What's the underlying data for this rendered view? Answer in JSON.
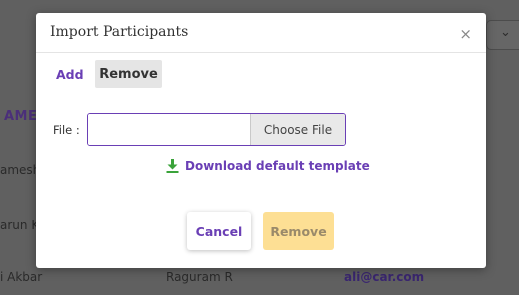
{
  "background": {
    "heading": "AME",
    "rows": [
      {
        "name": "amesh"
      },
      {
        "name": "arun K"
      },
      {
        "name": "i Akbar",
        "col2": "Raguram R",
        "email": "ali@car.com"
      }
    ]
  },
  "modal": {
    "title": "Import Participants",
    "close_glyph": "×",
    "tabs": [
      {
        "label": "Add",
        "active": false
      },
      {
        "label": "Remove",
        "active": true
      }
    ],
    "file_label": "File :",
    "file_path_value": "",
    "choose_file_label": "Choose File",
    "download_label": "Download default template",
    "download_icon": "download-icon",
    "cancel_label": "Cancel",
    "remove_label": "Remove"
  },
  "colors": {
    "accent": "#6a3fb5",
    "download_icon": "#3aa33a",
    "remove_button_bg": "#fddf94",
    "overlay": "#606060"
  }
}
